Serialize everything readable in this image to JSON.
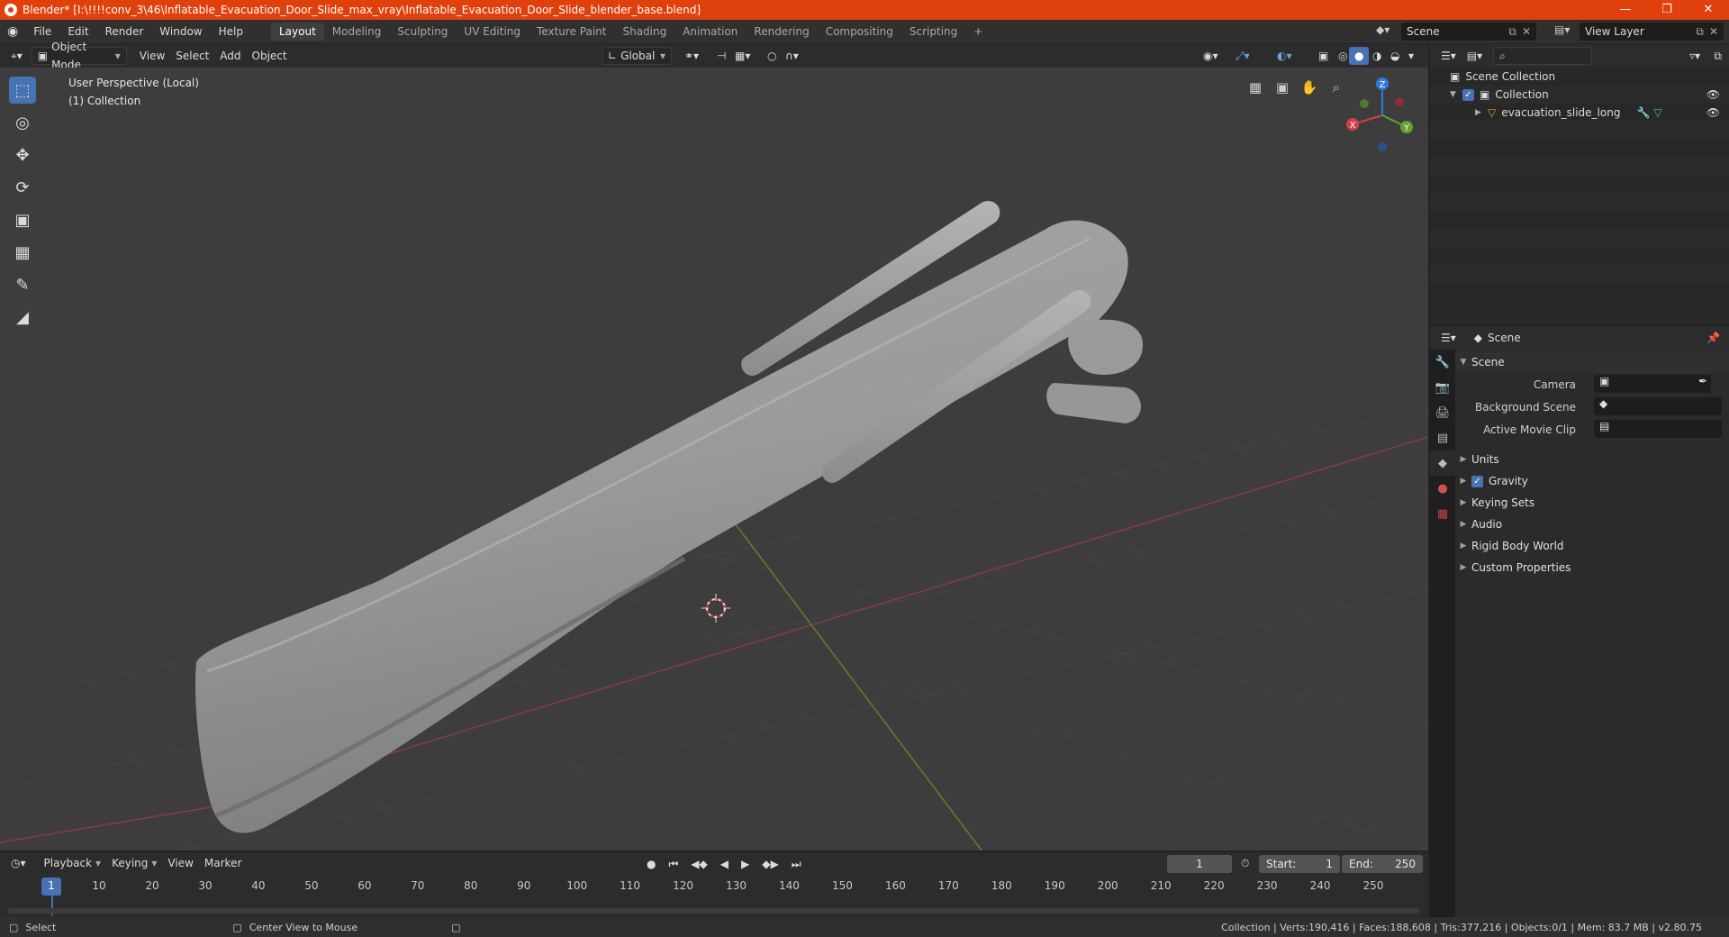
{
  "title_bar": {
    "text": "Blender* [I:\\!!!!conv_3\\46\\Inflatable_Evacuation_Door_Slide_max_vray\\Inflatable_Evacuation_Door_Slide_blender_base.blend]"
  },
  "menus": [
    "File",
    "Edit",
    "Render",
    "Window",
    "Help"
  ],
  "workspaces": [
    "Layout",
    "Modeling",
    "Sculpting",
    "UV Editing",
    "Texture Paint",
    "Shading",
    "Animation",
    "Rendering",
    "Compositing",
    "Scripting"
  ],
  "active_workspace": "Layout",
  "scene_name": "Scene",
  "view_layer": "View Layer",
  "header3d": {
    "mode": "Object Mode",
    "view": "View",
    "select": "Select",
    "add": "Add",
    "object": "Object",
    "orientation": "Global"
  },
  "viewport": {
    "perspective": "User Perspective (Local)",
    "collection": "(1) Collection"
  },
  "gizmo": {
    "x": "X",
    "y": "Y",
    "z": "Z"
  },
  "outliner": {
    "root": "Scene Collection",
    "collection": "Collection",
    "object": "evacuation_slide_long"
  },
  "properties": {
    "header": "Scene",
    "section": "Scene",
    "camera_label": "Camera",
    "bg_scene_label": "Background Scene",
    "movie_clip_label": "Active Movie Clip",
    "panels": [
      "Units",
      "Gravity",
      "Keying Sets",
      "Audio",
      "Rigid Body World",
      "Custom Properties"
    ]
  },
  "timeline": {
    "playback": "Playback",
    "keying": "Keying",
    "view": "View",
    "marker": "Marker",
    "current_frame": "1",
    "start_label": "Start:",
    "start": "1",
    "end_label": "End:",
    "end": "250",
    "ticks": [
      "1",
      "10",
      "20",
      "30",
      "40",
      "50",
      "60",
      "70",
      "80",
      "90",
      "100",
      "110",
      "120",
      "130",
      "140",
      "150",
      "160",
      "170",
      "180",
      "190",
      "200",
      "210",
      "220",
      "230",
      "240",
      "250"
    ]
  },
  "status": {
    "select": "Select",
    "center": "Center View to Mouse",
    "stats": "Collection | Verts:190,416 | Faces:188,608 | Tris:377,216 | Objects:0/1 | Mem: 83.7 MB | v2.80.75"
  }
}
